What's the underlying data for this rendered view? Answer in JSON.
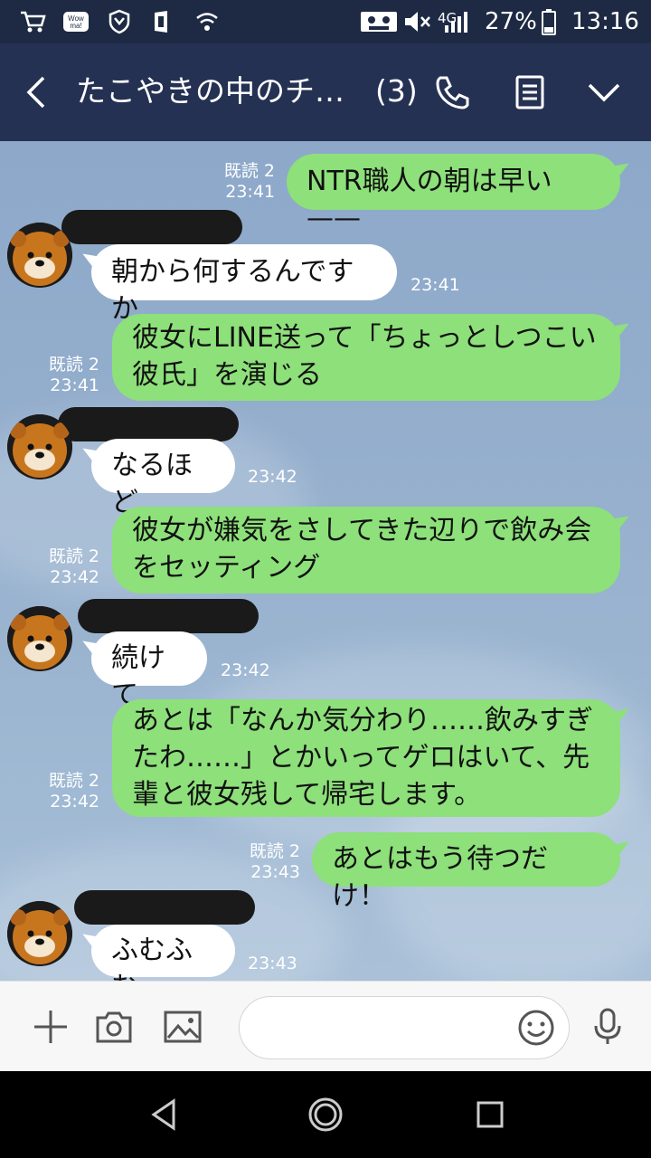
{
  "status_bar": {
    "network": "4G",
    "battery": "27%",
    "time": "13:16",
    "icons": [
      "cart-icon",
      "wowma-icon",
      "shield-icon",
      "office-icon",
      "wifi-icon",
      "cassette-icon",
      "mute-icon",
      "signal-icon",
      "battery-icon"
    ]
  },
  "header": {
    "title": "たこやきの中のチ…",
    "count": "(3)",
    "icons": [
      "back-icon",
      "phone-icon",
      "notes-icon",
      "chevron-down-icon"
    ]
  },
  "colors": {
    "header_bg": "#253152",
    "my_bubble": "#8de07a",
    "their_bubble": "#ffffff"
  },
  "messages": [
    {
      "from": "me",
      "lines": [
        "NTR職人の朝は早い——"
      ],
      "read": "既読 2",
      "time": "23:41"
    },
    {
      "from": "them",
      "lines": [
        "朝から何するんですか"
      ],
      "time": "23:41"
    },
    {
      "from": "me",
      "lines": [
        "彼女にLINE送って「ちょっとしつこい",
        "彼氏」を演じる"
      ],
      "read": "既読 2",
      "time": "23:41"
    },
    {
      "from": "them",
      "lines": [
        "なるほど"
      ],
      "time": "23:42"
    },
    {
      "from": "me",
      "lines": [
        "彼女が嫌気をさしてきた辺りで飲み会",
        "をセッティング"
      ],
      "read": "既読 2",
      "time": "23:42"
    },
    {
      "from": "them",
      "lines": [
        "続けて"
      ],
      "time": "23:42"
    },
    {
      "from": "me",
      "lines": [
        "あとは「なんか気分わり……飲みすぎ",
        "たわ……」とかいってゲロはいて、先",
        "輩と彼女残して帰宅します。"
      ],
      "read": "既読 2",
      "time": "23:42"
    },
    {
      "from": "me",
      "lines": [
        "あとはもう待つだけ！"
      ],
      "read": "既読 2",
      "time": "23:43"
    },
    {
      "from": "them",
      "lines": [
        "ふむふむ"
      ],
      "time": "23:43"
    }
  ],
  "input_bar": {
    "placeholder": "",
    "icons": [
      "plus-icon",
      "camera-icon",
      "image-icon",
      "emoji-icon",
      "mic-icon"
    ]
  },
  "nav_bar": {
    "icons": [
      "back-triangle-icon",
      "home-circle-icon",
      "recents-square-icon"
    ]
  }
}
